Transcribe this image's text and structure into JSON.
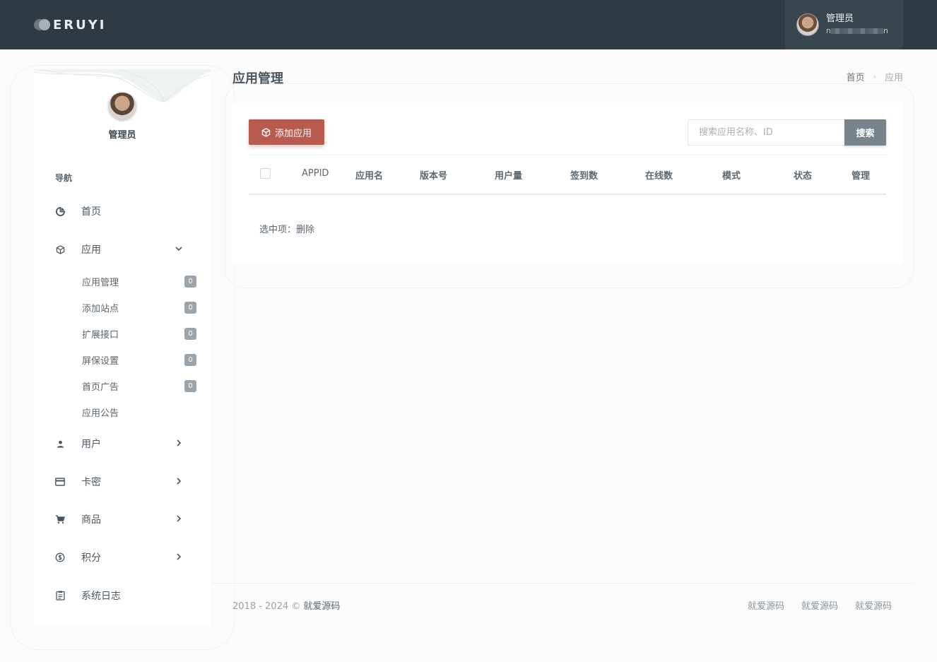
{
  "header": {
    "brand": "ERUYI",
    "user": {
      "name": "管理员",
      "account_prefix": "n",
      "account_suffix": "n"
    }
  },
  "sidebar": {
    "role": "管理员",
    "nav_title": "导航",
    "items": [
      {
        "label": "首页",
        "icon": "dashboard-icon"
      },
      {
        "label": "应用",
        "icon": "cube-icon",
        "expanded": true
      },
      {
        "label": "用户",
        "icon": "user-icon"
      },
      {
        "label": "卡密",
        "icon": "card-icon"
      },
      {
        "label": "商品",
        "icon": "cart-icon"
      },
      {
        "label": "积分",
        "icon": "coin-icon"
      },
      {
        "label": "系统日志",
        "icon": "log-icon"
      }
    ],
    "sub_items": [
      {
        "label": "应用管理",
        "badge": "0"
      },
      {
        "label": "添加站点",
        "badge": "0"
      },
      {
        "label": "扩展接口",
        "badge": "0"
      },
      {
        "label": "屏保设置",
        "badge": "0"
      },
      {
        "label": "首页广告",
        "badge": "0"
      },
      {
        "label": "应用公告"
      }
    ]
  },
  "page": {
    "title": "应用管理",
    "breadcrumb": {
      "home": "首页",
      "separator": "›",
      "current": "应用"
    }
  },
  "toolbar": {
    "add_label": "添加应用",
    "search_placeholder": "搜索应用名称、ID",
    "search_label": "搜索"
  },
  "table": {
    "columns": [
      "APPID",
      "应用名",
      "版本号",
      "用户量",
      "签到数",
      "在线数",
      "模式",
      "状态",
      "管理"
    ]
  },
  "bulk": {
    "label": "选中项：",
    "delete": "删除"
  },
  "footer": {
    "copyright": "2018 - 2024 ©",
    "brand": "就爱源码",
    "links": [
      "就爱源码",
      "就爱源码",
      "就爱源码"
    ]
  },
  "colors": {
    "topbar": "#2f3a42",
    "accent_add": "#b85a4e",
    "search_button": "#77848c",
    "badge": "#9ba4aa"
  }
}
